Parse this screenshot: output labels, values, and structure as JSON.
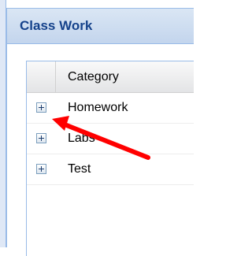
{
  "panel": {
    "title": "Class Work"
  },
  "grid": {
    "column_header": "Category",
    "rows": [
      {
        "label": "Homework",
        "expander_icon": "plus-box-icon"
      },
      {
        "label": "Labs",
        "expander_icon": "plus-box-icon"
      },
      {
        "label": "Test",
        "expander_icon": "plus-box-icon"
      }
    ]
  },
  "annotation": {
    "color": "#ff0000",
    "shape": "arrow pointing left toward the Homework expander"
  },
  "colors": {
    "title_text": "#15428b",
    "panel_border": "#99bbe8",
    "header_bg": "#c3d5ed"
  }
}
